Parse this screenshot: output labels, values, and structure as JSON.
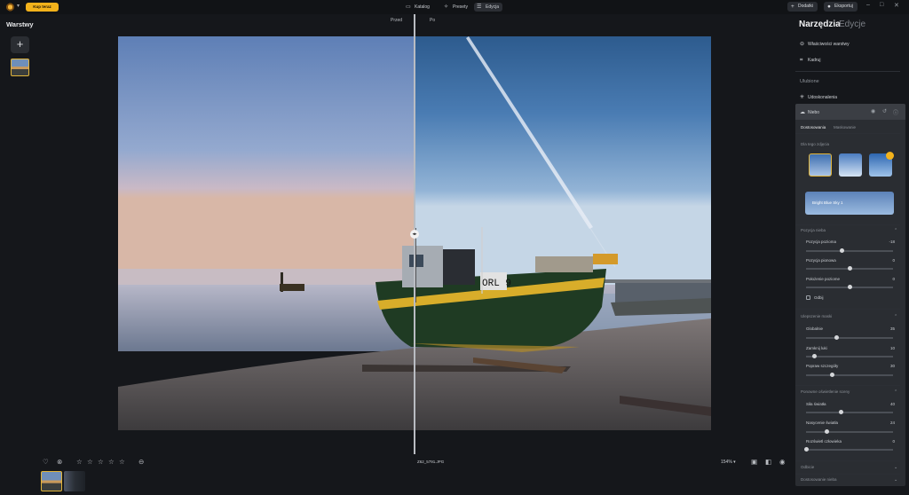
{
  "topbar": {
    "buy_label": "Kup teraz",
    "tabs": [
      {
        "label": "Katalog",
        "icon": "folder-icon"
      },
      {
        "label": "Presety",
        "icon": "presets-icon"
      },
      {
        "label": "Edycja",
        "icon": "edit-icon"
      }
    ],
    "addons_label": "Dodatki",
    "export_label": "Eksportuj"
  },
  "left": {
    "title": "Warstwy"
  },
  "canvas": {
    "before_label": "Przed",
    "after_label": "Po"
  },
  "bottom": {
    "filename": "Z62_5791.JPG",
    "zoom": "154%",
    "rating_stars": 5
  },
  "right": {
    "tab_tools": "Narzędzia",
    "tab_edits": "Edycje",
    "layer_props": "Właściwości warstwy",
    "crop": "Kadruj",
    "favorites": "Ulubione",
    "enhance": "Udoskonalenia",
    "sky": {
      "title": "Niebo",
      "subtab_adjust": "Dostosowania",
      "subtab_mask": "Maskowanie",
      "for_photo": "Dla tego zdjęcia",
      "banner": "Bright Blue Sky 1",
      "position_section": "Pozycja nieba",
      "sliders_position": [
        {
          "label": "Pozycja pozioma",
          "value": "-18",
          "frac": 0.41
        },
        {
          "label": "Pozycja pionowa",
          "value": "0",
          "frac": 0.5
        },
        {
          "label": "Położenie poziome",
          "value": "0",
          "frac": 0.5
        }
      ],
      "flip": "Odbij",
      "mask_section": "Ulepszenie maski",
      "sliders_mask": [
        {
          "label": "Globalnie",
          "value": "35",
          "frac": 0.35
        },
        {
          "label": "Zamknij luki",
          "value": "10",
          "frac": 0.1
        },
        {
          "label": "Popraw szczegóły",
          "value": "30",
          "frac": 0.3
        }
      ],
      "relight_section": "Ponowne oświetlenie sceny",
      "sliders_relight": [
        {
          "label": "Siła światła",
          "value": "40",
          "frac": 0.4
        },
        {
          "label": "Nasycenie światła",
          "value": "24",
          "frac": 0.24
        },
        {
          "label": "Rozświetl człowieka",
          "value": "0",
          "frac": 0.0
        }
      ],
      "reflection": "Odbicie",
      "sky_adjust": "Dostosowanie nieba"
    }
  }
}
